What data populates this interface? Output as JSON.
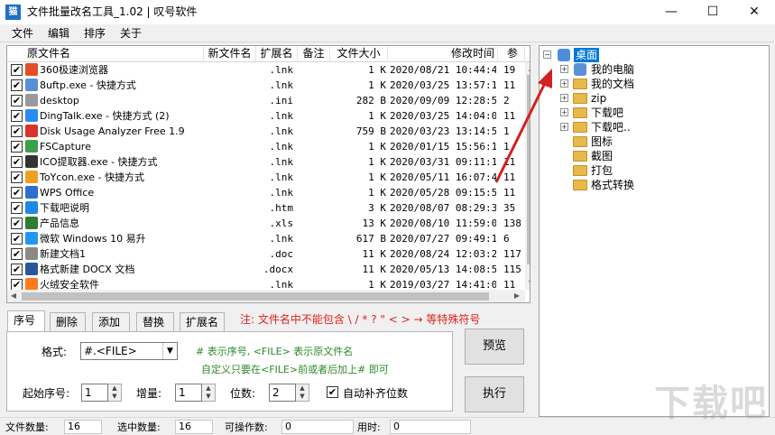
{
  "window": {
    "title": "文件批量改名工具_1.02 | 叹号软件",
    "icon_text": "猫",
    "minimize": "—",
    "maximize": "☐",
    "close": "✕"
  },
  "menu": [
    "文件",
    "编辑",
    "排序",
    "关于"
  ],
  "columns": [
    "原文件名",
    "新文件名",
    "扩展名",
    "备注",
    "文件大小",
    "修改时间",
    "参"
  ],
  "files": [
    {
      "name": "360极速浏览器",
      "ext": ".lnk",
      "size": "1 K",
      "modified": "2020/08/21 10:44:42",
      "extra": "19",
      "icon_color": "#e44d26"
    },
    {
      "name": "8uftp.exe - 快捷方式",
      "ext": ".lnk",
      "size": "1 K",
      "modified": "2020/03/25 13:57:15",
      "extra": "11",
      "icon_color": "#5a8fd6"
    },
    {
      "name": "desktop",
      "ext": ".ini",
      "size": "282 B",
      "modified": "2020/09/09 12:28:55",
      "extra": "2",
      "icon_color": "#9a9a9a"
    },
    {
      "name": "DingTalk.exe - 快捷方式 (2)",
      "ext": ".lnk",
      "size": "1 K",
      "modified": "2020/03/25 14:04:00",
      "extra": "11",
      "icon_color": "#2a8cf0"
    },
    {
      "name": "Disk Usage Analyzer Free 1.9",
      "ext": ".lnk",
      "size": "759 B",
      "modified": "2020/03/23 13:14:56",
      "extra": "1",
      "icon_color": "#d9342b"
    },
    {
      "name": "FSCapture",
      "ext": ".lnk",
      "size": "1 K",
      "modified": "2020/01/15 15:56:11",
      "extra": "1",
      "icon_color": "#3da04a"
    },
    {
      "name": "ICO提取器.exe - 快捷方式",
      "ext": ".lnk",
      "size": "1 K",
      "modified": "2020/03/31 09:11:16",
      "extra": "11",
      "icon_color": "#333333"
    },
    {
      "name": "ToYcon.exe - 快捷方式",
      "ext": ".lnk",
      "size": "1 K",
      "modified": "2020/05/11 16:07:47",
      "extra": "11",
      "icon_color": "#f0a020"
    },
    {
      "name": "WPS Office",
      "ext": ".lnk",
      "size": "1 K",
      "modified": "2020/05/28 09:15:57",
      "extra": "11",
      "icon_color": "#2c6fcf"
    },
    {
      "name": "下载吧说明",
      "ext": ".htm",
      "size": "3 K",
      "modified": "2020/08/07 08:29:36",
      "extra": "35",
      "icon_color": "#1e88e5"
    },
    {
      "name": "产品信息",
      "ext": ".xls",
      "size": "13 K",
      "modified": "2020/08/10 11:59:07",
      "extra": "138",
      "icon_color": "#2e7d32"
    },
    {
      "name": "微软 Windows 10 易升",
      "ext": ".lnk",
      "size": "617 B",
      "modified": "2020/07/27 09:49:12",
      "extra": "6",
      "icon_color": "#2196f3"
    },
    {
      "name": "新建文档1",
      "ext": ".doc",
      "size": "11 K",
      "modified": "2020/08/24 12:03:21",
      "extra": "117",
      "icon_color": "#8a8a8a"
    },
    {
      "name": "格式新建 DOCX 文档",
      "ext": ".docx",
      "size": "11 K",
      "modified": "2020/05/13 14:08:51",
      "extra": "115",
      "icon_color": "#2b579a"
    },
    {
      "name": "火绒安全软件",
      "ext": ".lnk",
      "size": "1 K",
      "modified": "2019/03/27 14:41:09",
      "extra": "11",
      "icon_color": "#ff7a1a"
    }
  ],
  "tree": {
    "root": "桌面",
    "nodes": [
      {
        "label": "我的电脑",
        "type": "pc",
        "level": 1,
        "expander": "+"
      },
      {
        "label": "我的文档",
        "type": "folder",
        "level": 1,
        "expander": "+"
      },
      {
        "label": "zip",
        "type": "folder",
        "level": 1,
        "expander": "+"
      },
      {
        "label": "下载吧",
        "type": "folder",
        "level": 1,
        "expander": "+"
      },
      {
        "label": "下载吧..",
        "type": "folder",
        "level": 1,
        "expander": "+"
      },
      {
        "label": "图标",
        "type": "folder",
        "level": 1,
        "expander": ""
      },
      {
        "label": "截图",
        "type": "folder",
        "level": 1,
        "expander": ""
      },
      {
        "label": "打包",
        "type": "folder",
        "level": 1,
        "expander": ""
      },
      {
        "label": "格式转换",
        "type": "folder",
        "level": 1,
        "expander": ""
      }
    ]
  },
  "tabs": [
    "序号",
    "删除",
    "添加",
    "替换",
    "扩展名"
  ],
  "note": "注: 文件名中不能包含 \\ / * ? \" < > → 等特殊符号",
  "format": {
    "label": "格式:",
    "value": "#.<FILE>",
    "hint1": "# 表示序号, <FILE> 表示原文件名",
    "hint2": "自定义只要在<FILE>前或者后加上# 即可"
  },
  "numbering": {
    "start_label": "起始序号:",
    "start_value": "1",
    "step_label": "增量:",
    "step_value": "1",
    "digits_label": "位数:",
    "digits_value": "2",
    "pad_label": "自动补齐位数",
    "pad_checked": "✔"
  },
  "buttons": {
    "preview": "预览",
    "execute": "执行"
  },
  "status": {
    "file_count_label": "文件数量:",
    "file_count": "16",
    "selected_label": "选中数量:",
    "selected": "16",
    "operable_label": "可操作数:",
    "operable": "0",
    "time_label": "用时:",
    "time": "0"
  },
  "watermark": "下载吧",
  "colors": {
    "accent": "#0078d7",
    "note_red": "#e02020",
    "hint_green": "#2c8a2c",
    "arrow_red": "#d32020"
  }
}
